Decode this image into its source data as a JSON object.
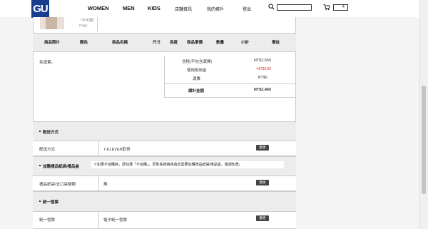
{
  "header": {
    "logo": "GU",
    "nav": [
      "WOMEN",
      "MEN",
      "KIDS"
    ],
    "links": [
      "店舖資訊",
      "我的帳戶",
      "登出"
    ],
    "cart_count": "4"
  },
  "product": {
    "color_text": "（不可選）",
    "color_name": "PINK"
  },
  "table_headers": [
    "商品照片",
    "顏色",
    "商品名稱",
    "尺寸",
    "長度",
    "商品單價",
    "數量",
    "小計",
    "備註"
  ],
  "summary": {
    "shipping_note": "免運費。",
    "rows": [
      {
        "label": "含稅(不包含運費)",
        "value": "NT$2,560"
      },
      {
        "label": "使用抵用金",
        "value": "-NT$100"
      },
      {
        "label": "運費",
        "value": "NT$0"
      }
    ],
    "total_label": "總計金額",
    "total_value": "NT$2,460"
  },
  "delivery": {
    "section_title": "配送方式",
    "label": "配送方式",
    "value": "7-ELEVEN取貨",
    "button": "變更"
  },
  "gift": {
    "section_title": "加購禮品紙袋/禮品盒",
    "notice": "※如果不加購時，請勾選「不加購」，否則系統將視為您需要加購禮品紙袋/禮品盒，敬請知悉。",
    "label": "禮品紙袋/支口袋樣類",
    "value": "無",
    "button": "變更"
  },
  "invoice": {
    "section_title": "統一發票",
    "label": "統一發票",
    "value": "電子統一發票",
    "button": "變更"
  },
  "colors": {
    "logo_bg": "#1a3e8f",
    "discount": "#d03a2a",
    "button_bg": "#444444"
  }
}
